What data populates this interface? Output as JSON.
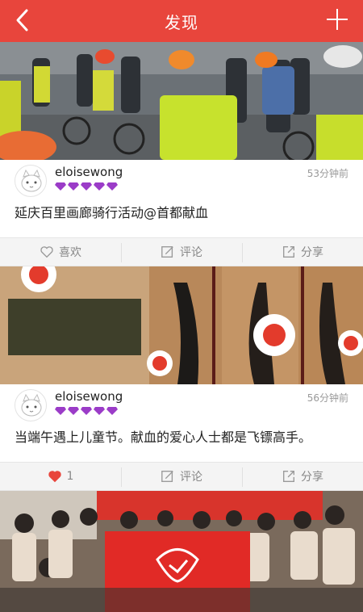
{
  "header": {
    "title": "发现"
  },
  "posts": [
    {
      "username": "eloisewong",
      "time": "53分钟前",
      "text": "延庆百里画廊骑行活动@首都献血",
      "like_label": "喜欢",
      "comment_label": "评论",
      "share_label": "分享"
    },
    {
      "username": "eloisewong",
      "time": "56分钟前",
      "text": "当端午遇上儿童节。献血的爱心人士都是飞镖高手。",
      "like_count": "1",
      "comment_label": "评论",
      "share_label": "分享"
    }
  ],
  "colors": {
    "accent": "#e8453c",
    "gem": "#9b3cc8"
  }
}
